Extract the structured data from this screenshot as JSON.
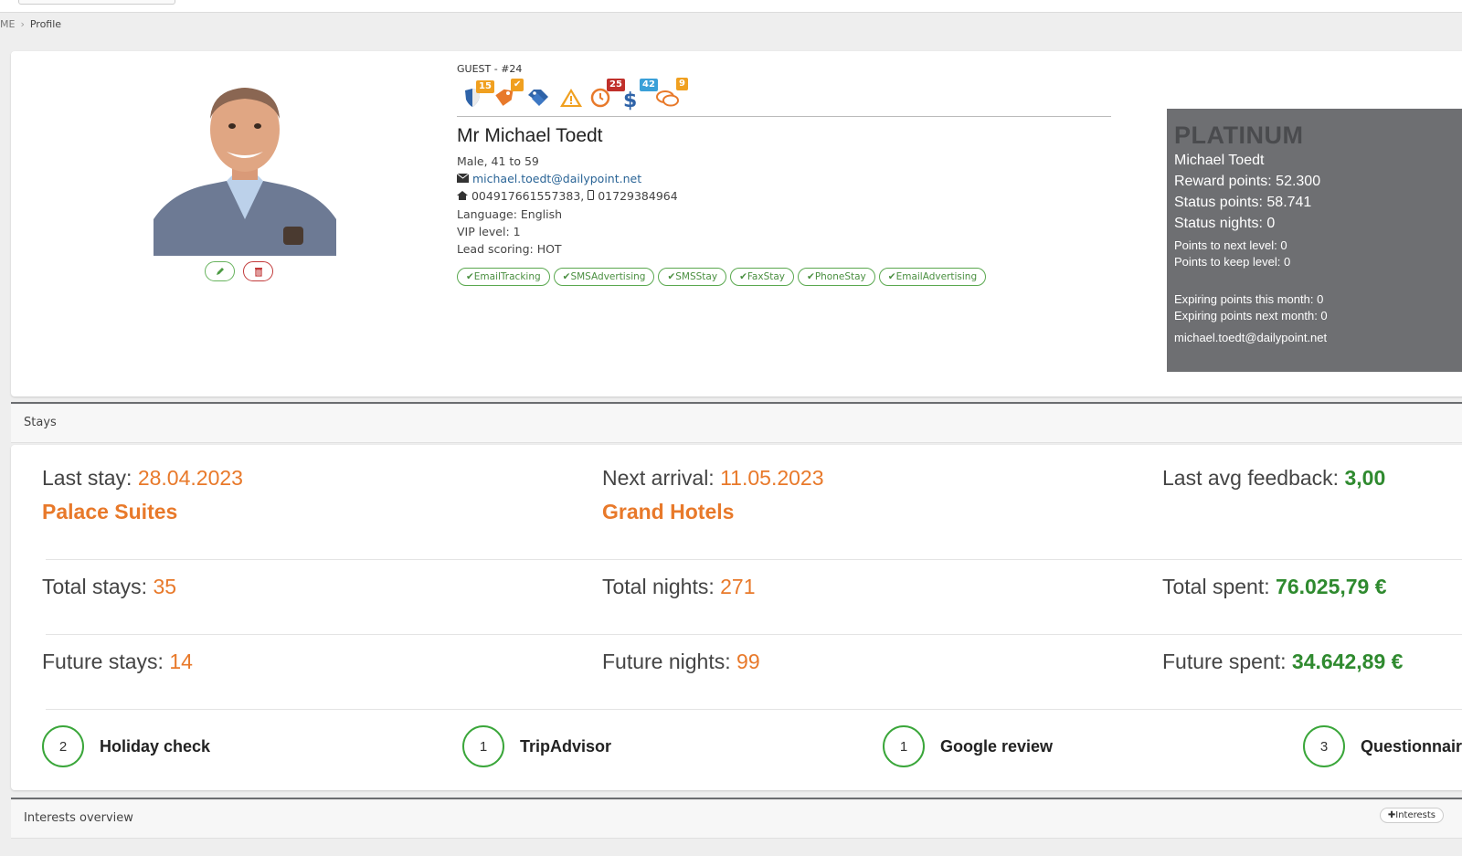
{
  "breadcrumb": {
    "home": "ME",
    "separator": "›",
    "current": "Profile"
  },
  "guest": {
    "label": "GUEST - #24",
    "icons": [
      {
        "name": "shield-icon",
        "badge": "15",
        "badge_color": "#f0a020"
      },
      {
        "name": "tag-icon",
        "badge": "✔",
        "badge_color": "#f0a020"
      },
      {
        "name": "tags-icon"
      },
      {
        "name": "warning-icon"
      },
      {
        "name": "clock-icon",
        "badge": "25",
        "badge_color": "#c0302b"
      },
      {
        "name": "dollar-icon",
        "badge": "42",
        "badge_color": "#3aa0d8"
      },
      {
        "name": "comments-icon",
        "badge": "9",
        "badge_color": "#f0a020"
      }
    ],
    "name": "Mr Michael Toedt",
    "gender_age": "Male, 41 to 59",
    "email": "michael.toedt@dailypoint.net",
    "phone": "004917661557383, ",
    "mobile": "01729384964",
    "language": "Language: English",
    "vip": "VIP level: 1",
    "lead": "Lead scoring: HOT",
    "tags": [
      "✔EmailTracking",
      "✔SMSAdvertising",
      "✔SMSStay",
      "✔FaxStay",
      "✔PhoneStay",
      "✔EmailAdvertising"
    ]
  },
  "loyalty": {
    "level": "PLATINUM",
    "name": "Michael Toedt",
    "reward": "Reward points: 52.300",
    "status_points": "Status points: 58.741",
    "status_nights": "Status nights: 0",
    "next_level": "Points to next level: 0",
    "keep_level": "Points to keep level: 0",
    "exp_this": "Expiring points this month: 0",
    "exp_next": "Expiring points next month: 0",
    "email": "michael.toedt@dailypoint.net"
  },
  "stays": {
    "header": "Stays",
    "last_stay_label": "Last stay: ",
    "last_stay_date": "28.04.2023",
    "last_stay_hotel": "Palace Suites",
    "next_arrival_label": "Next arrival: ",
    "next_arrival_date": "11.05.2023",
    "next_arrival_hotel": "Grand Hotels",
    "feedback_label": "Last avg feedback: ",
    "feedback_value": "3,00",
    "total_stays_label": "Total stays: ",
    "total_stays": "35",
    "total_nights_label": "Total nights: ",
    "total_nights": "271",
    "total_spent_label": "Total spent: ",
    "total_spent": "76.025,79 €",
    "future_stays_label": "Future stays: ",
    "future_stays": "14",
    "future_nights_label": "Future nights: ",
    "future_nights": "99",
    "future_spent_label": "Future spent: ",
    "future_spent": "34.642,89 €",
    "reviews": [
      {
        "count": "2",
        "label": "Holiday check"
      },
      {
        "count": "1",
        "label": "TripAdvisor"
      },
      {
        "count": "1",
        "label": "Google review"
      },
      {
        "count": "3",
        "label": "Questionnaire"
      }
    ]
  },
  "interests": {
    "header": "Interests overview",
    "button": "✚Interests"
  },
  "colors": {
    "accent_orange": "#e8792a",
    "accent_green": "#2f8a2f",
    "loyalty_bg": "#6e6f72"
  }
}
